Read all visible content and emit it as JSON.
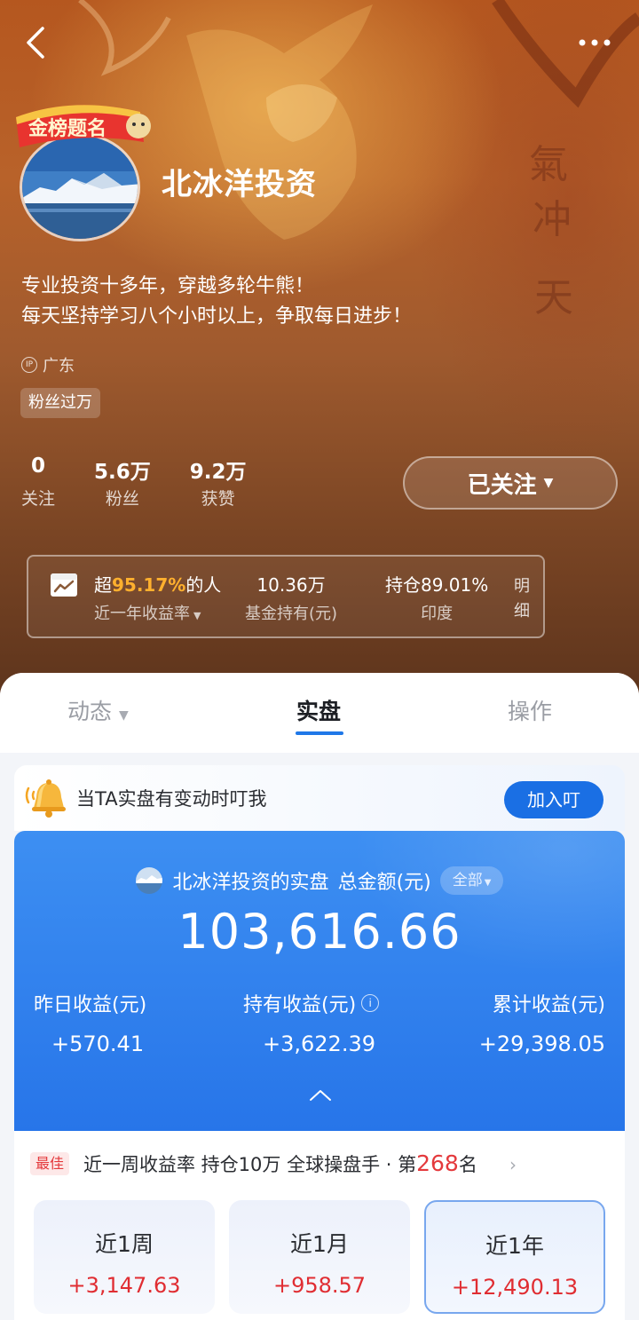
{
  "header": {
    "back_icon": "chevron-left-icon",
    "more_icon": "more-dots-icon"
  },
  "profile": {
    "username": "北冰洋投资",
    "badge_text": "金榜题名",
    "bio_line1": "专业投资十多年，穿越多轮牛熊！",
    "bio_line2": "每天坚持学习八个小时以上，争取每日进步！",
    "ip_label": "广东",
    "fan_badge": "粉丝过万"
  },
  "stats": [
    {
      "value": "0",
      "label": "关注"
    },
    {
      "value": "5.6万",
      "label": "粉丝"
    },
    {
      "value": "9.2万",
      "label": "获赞"
    }
  ],
  "follow_button": {
    "label": "已关注"
  },
  "summary": {
    "beat_prefix": "超",
    "beat_percent": "95.17%",
    "beat_suffix": "的人",
    "beat_label": "近一年收益率",
    "holding_value": "10.36万",
    "holding_label": "基金持有(元)",
    "position_value": "持仓89.01%",
    "position_label": "印度",
    "detail_link": "明细"
  },
  "tabs": [
    {
      "label": "动态"
    },
    {
      "label": "实盘"
    },
    {
      "label": "操作"
    }
  ],
  "notify": {
    "text": "当TA实盘有变动时叮我",
    "button": "加入叮"
  },
  "portfolio": {
    "owner": "北冰洋投资的实盘",
    "total_label": "总金额(元)",
    "scope": "全部",
    "total_amount": "103,616.66",
    "metrics": [
      {
        "label": "昨日收益(元)",
        "value": "+570.41"
      },
      {
        "label": "持有收益(元)",
        "value": "+3,622.39"
      },
      {
        "label": "累计收益(元)",
        "value": "+29,398.05"
      }
    ]
  },
  "ranking": {
    "tag": "最佳",
    "text_prefix": "近一周收益率 持仓10万 全球操盘手 · 第",
    "rank": "268",
    "text_suffix": "名"
  },
  "periods": [
    {
      "label": "近1周",
      "value": "+3,147.63"
    },
    {
      "label": "近1月",
      "value": "+958.57"
    },
    {
      "label": "近1年",
      "value": "+12,490.13"
    }
  ],
  "colors": {
    "accent_blue": "#1a6fe4",
    "gain_red": "#e02d32",
    "highlight_orange": "#ffb02e"
  }
}
